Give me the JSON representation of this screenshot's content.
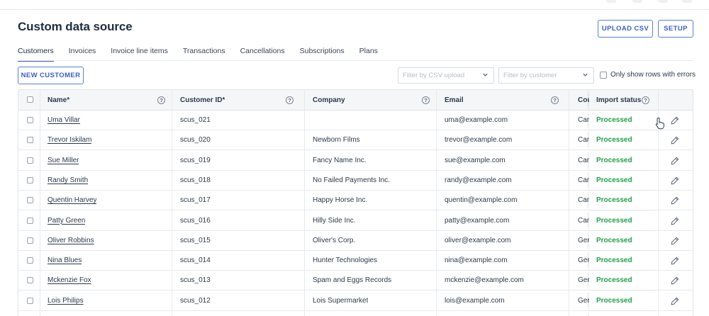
{
  "page": {
    "title": "Custom data source",
    "upload_button": "UPLOAD CSV",
    "setup_button": "SETUP",
    "new_customer_button": "NEW CUSTOMER"
  },
  "tabs": [
    {
      "label": "Customers",
      "active": true
    },
    {
      "label": "Invoices"
    },
    {
      "label": "Invoice line items"
    },
    {
      "label": "Transactions"
    },
    {
      "label": "Cancellations"
    },
    {
      "label": "Subscriptions"
    },
    {
      "label": "Plans"
    }
  ],
  "filters": {
    "csv_placeholder": "Filter by CSV upload",
    "customer_placeholder": "Filter by customer",
    "errors_only_label": "Only show rows with errors"
  },
  "table": {
    "headers": {
      "name": "Name*",
      "customer_id": "Customer ID*",
      "company": "Company",
      "email": "Email",
      "country": "Cou",
      "import_status": "Import status"
    },
    "rows": [
      {
        "name": "Uma Villar",
        "customer_id": "scus_021",
        "company": "",
        "email": "uma@example.com",
        "country": "Can",
        "status": "Processed"
      },
      {
        "name": "Trevor Iskilam",
        "customer_id": "scus_020",
        "company": "Newborn Films",
        "email": "trevor@example.com",
        "country": "Can",
        "status": "Processed"
      },
      {
        "name": "Sue Miller",
        "customer_id": "scus_019",
        "company": "Fancy Name Inc.",
        "email": "sue@example.com",
        "country": "Can",
        "status": "Processed"
      },
      {
        "name": "Randy Smith",
        "customer_id": "scus_018",
        "company": "No Failed Payments Inc.",
        "email": "randy@example.com",
        "country": "Can",
        "status": "Processed"
      },
      {
        "name": "Quentin Harvey",
        "customer_id": "scus_017",
        "company": "Happy Horse Inc.",
        "email": "quentin@example.com",
        "country": "Can",
        "status": "Processed"
      },
      {
        "name": "Patty Green",
        "customer_id": "scus_016",
        "company": "Hilly Side Inc.",
        "email": "patty@example.com",
        "country": "Can",
        "status": "Processed"
      },
      {
        "name": "Oliver Robbins",
        "customer_id": "scus_015",
        "company": "Oliver's Corp.",
        "email": "oliver@example.com",
        "country": "Ger",
        "status": "Processed"
      },
      {
        "name": "Nina Blues",
        "customer_id": "scus_014",
        "company": "Hunter Technologies",
        "email": "nina@example.com",
        "country": "Ger",
        "status": "Processed"
      },
      {
        "name": "Mckenzie Fox",
        "customer_id": "scus_013",
        "company": "Spam and Eggs Records",
        "email": "mckenzie@example.com",
        "country": "Ger",
        "status": "Processed"
      },
      {
        "name": "Lois Philips",
        "customer_id": "scus_012",
        "company": "Lois Supermarket",
        "email": "lois@example.com",
        "country": "Ger",
        "status": "Processed"
      }
    ]
  },
  "colors": {
    "accent": "#3a5fc8",
    "processed": "#23a04a"
  },
  "icons": {
    "help": "question-circle-icon",
    "edit": "pencil-icon",
    "dropdown": "chevron-down-icon",
    "cursor": "hand-pointer-icon"
  }
}
